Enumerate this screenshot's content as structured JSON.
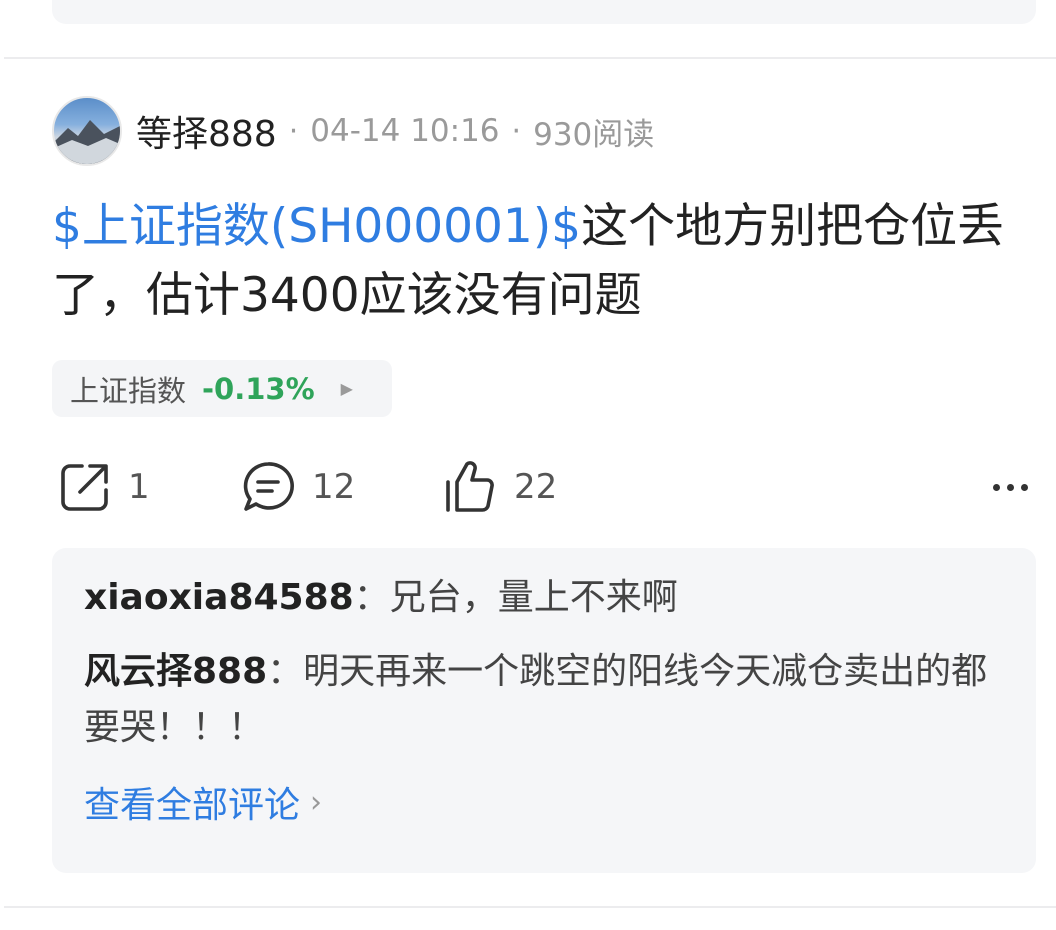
{
  "post": {
    "author": "等择888",
    "separator": "·",
    "date": "04-14 10:16",
    "reads": "930阅读",
    "stock_mention": "$上证指数(SH000001)$",
    "body_text": "这个地方别把仓位丢了，估计3400应该没有问题"
  },
  "tag": {
    "name": "上证指数",
    "change": "-0.13%",
    "change_color": "#2fa45a",
    "arrow": "▶"
  },
  "actions": {
    "share_count": "1",
    "comment_count": "12",
    "like_count": "22"
  },
  "comments": [
    {
      "user": "xiaoxia84588",
      "colon": "：",
      "text": "兄台，量上不来啊"
    },
    {
      "user": "风云择888",
      "colon": "：",
      "text": "明天再来一个跳空的阳线今天减仓卖出的都要哭！！！"
    }
  ],
  "view_all": {
    "label": "查看全部评论",
    "chevron": "›"
  },
  "colors": {
    "link": "#2f7de1",
    "down": "#2fa45a"
  },
  "icons": {
    "share": "share-icon",
    "comment": "comment-icon",
    "like": "thumbs-up-icon",
    "more": "more-icon"
  }
}
